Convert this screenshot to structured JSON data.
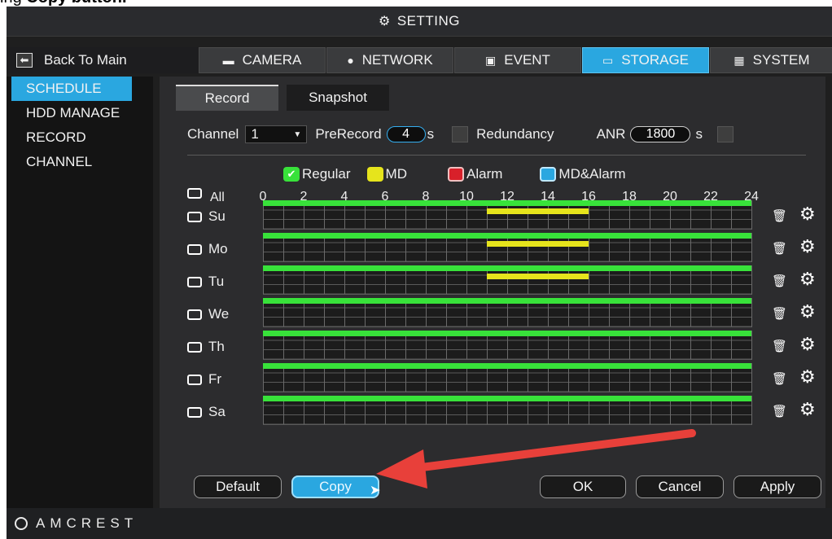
{
  "header": {
    "title": "SETTING",
    "cropped_caption_plain": "ing ",
    "cropped_caption_bold": "Copy button."
  },
  "nav": {
    "back_label": "Back To Main",
    "tabs": [
      {
        "label": "CAMERA",
        "icon": "camera-icon"
      },
      {
        "label": "NETWORK",
        "icon": "globe-icon"
      },
      {
        "label": "EVENT",
        "icon": "event-icon"
      },
      {
        "label": "STORAGE",
        "icon": "monitor-icon",
        "active": true
      },
      {
        "label": "SYSTEM",
        "icon": "system-icon"
      }
    ]
  },
  "sidebar": {
    "items": [
      {
        "label": "SCHEDULE",
        "active": true
      },
      {
        "label": "HDD MANAGE"
      },
      {
        "label": "RECORD"
      },
      {
        "label": "CHANNEL"
      }
    ]
  },
  "subtabs": [
    {
      "label": "Record",
      "active": true
    },
    {
      "label": "Snapshot"
    }
  ],
  "controls": {
    "channel_label": "Channel",
    "channel_value": "1",
    "prerecord_label": "PreRecord",
    "prerecord_value": "4",
    "prerecord_unit": "s",
    "redundancy_label": "Redundancy",
    "anr_label": "ANR",
    "anr_value": "1800",
    "anr_unit": "s"
  },
  "legend": [
    {
      "label": "Regular",
      "color": "#38e23a"
    },
    {
      "label": "MD",
      "color": "#e6e41c"
    },
    {
      "label": "Alarm",
      "color": "#d8202a"
    },
    {
      "label": "MD&Alarm",
      "color": "#2aa7e0"
    }
  ],
  "schedule": {
    "all_label": "All",
    "hours": [
      "0",
      "2",
      "4",
      "6",
      "8",
      "10",
      "12",
      "14",
      "16",
      "18",
      "20",
      "22",
      "24"
    ],
    "days": [
      {
        "label": "Su",
        "regular": [
          0,
          24
        ],
        "md": [
          11,
          16
        ]
      },
      {
        "label": "Mo",
        "regular": [
          0,
          24
        ],
        "md": [
          11,
          16
        ]
      },
      {
        "label": "Tu",
        "regular": [
          0,
          24
        ],
        "md": [
          11,
          16
        ]
      },
      {
        "label": "We",
        "regular": [
          0,
          24
        ],
        "md": null
      },
      {
        "label": "Th",
        "regular": [
          0,
          24
        ],
        "md": null
      },
      {
        "label": "Fr",
        "regular": [
          0,
          24
        ],
        "md": null
      },
      {
        "label": "Sa",
        "regular": [
          0,
          24
        ],
        "md": null
      }
    ]
  },
  "buttons": {
    "default": "Default",
    "copy": "Copy",
    "ok": "OK",
    "cancel": "Cancel",
    "apply": "Apply"
  },
  "footer": {
    "brand": "AMCREST"
  },
  "annotation": {
    "arrow_color": "#e8403a"
  }
}
